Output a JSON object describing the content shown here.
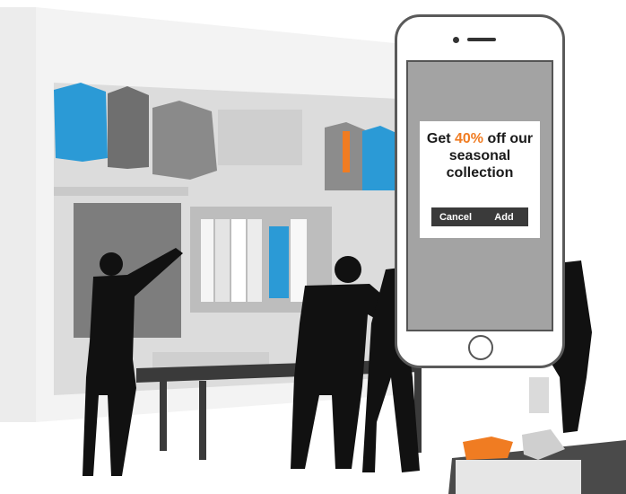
{
  "promo": {
    "line1_before": "Get ",
    "discount": "40%",
    "line1_after": " off our",
    "line2": "seasonal",
    "line3": "collection",
    "cancel_label": "Cancel",
    "add_label": "Add"
  },
  "colors": {
    "accent": "#f07c22",
    "garment_blue": "#2b9ad6",
    "silhouette": "#111111",
    "button_bg": "#3a3a3a"
  }
}
